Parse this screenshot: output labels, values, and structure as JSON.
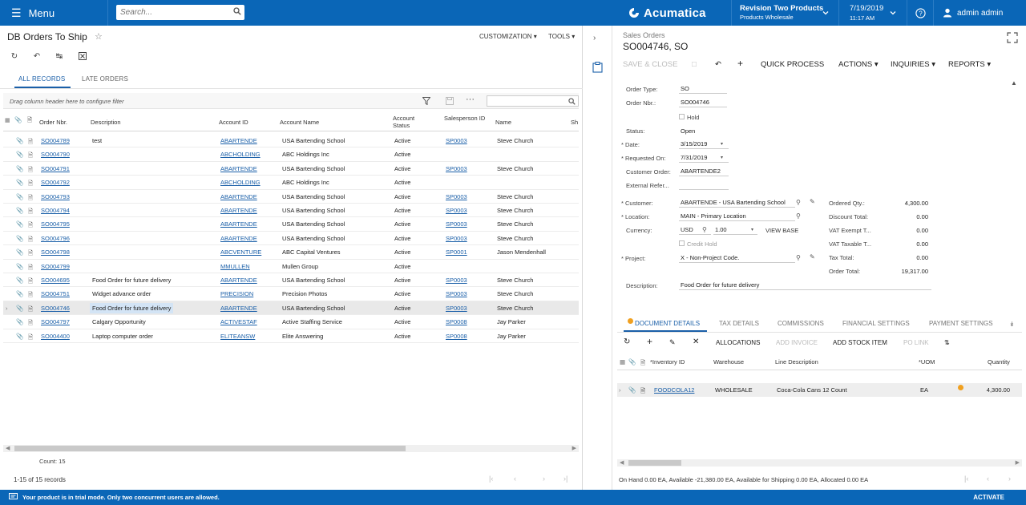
{
  "topbar": {
    "menu_label": "Menu",
    "search_placeholder": "Search...",
    "logo": "Acumatica",
    "company": "Revision Two Products",
    "branch": "Products Wholesale",
    "date": "7/19/2019",
    "time": "11:17 AM",
    "user": "admin admin"
  },
  "left": {
    "title": "DB Orders To Ship",
    "customization": "CUSTOMIZATION",
    "tools": "TOOLS",
    "tabs": [
      "ALL RECORDS",
      "LATE ORDERS"
    ],
    "drag_hint": "Drag column header here to configure filter",
    "columns": [
      "Order Nbr.",
      "Description",
      "Account ID",
      "Account Name",
      "Account Status",
      "Salesperson ID",
      "Name",
      "Sh"
    ],
    "rows": [
      {
        "order": "SO004789",
        "desc": "test",
        "acct": "ABARTENDE",
        "name": "USA Bartending School",
        "status": "Active",
        "sp": "SP0003",
        "spname": "Steve Church"
      },
      {
        "order": "SO004790",
        "desc": "",
        "acct": "ABCHOLDING",
        "name": "ABC Holdings Inc",
        "status": "Active",
        "sp": "",
        "spname": ""
      },
      {
        "order": "SO004791",
        "desc": "",
        "acct": "ABARTENDE",
        "name": "USA Bartending School",
        "status": "Active",
        "sp": "SP0003",
        "spname": "Steve Church"
      },
      {
        "order": "SO004792",
        "desc": "",
        "acct": "ABCHOLDING",
        "name": "ABC Holdings Inc",
        "status": "Active",
        "sp": "",
        "spname": ""
      },
      {
        "order": "SO004793",
        "desc": "",
        "acct": "ABARTENDE",
        "name": "USA Bartending School",
        "status": "Active",
        "sp": "SP0003",
        "spname": "Steve Church"
      },
      {
        "order": "SO004794",
        "desc": "",
        "acct": "ABARTENDE",
        "name": "USA Bartending School",
        "status": "Active",
        "sp": "SP0003",
        "spname": "Steve Church"
      },
      {
        "order": "SO004795",
        "desc": "",
        "acct": "ABARTENDE",
        "name": "USA Bartending School",
        "status": "Active",
        "sp": "SP0003",
        "spname": "Steve Church"
      },
      {
        "order": "SO004796",
        "desc": "",
        "acct": "ABARTENDE",
        "name": "USA Bartending School",
        "status": "Active",
        "sp": "SP0003",
        "spname": "Steve Church"
      },
      {
        "order": "SO004798",
        "desc": "",
        "acct": "ABCVENTURE",
        "name": "ABC Capital Ventures",
        "status": "Active",
        "sp": "SP0001",
        "spname": "Jason Mendenhall"
      },
      {
        "order": "SO004799",
        "desc": "",
        "acct": "MMULLEN",
        "name": "Mullen Group",
        "status": "Active",
        "sp": "",
        "spname": ""
      },
      {
        "order": "SO004695",
        "desc": "Food Order for future delivery",
        "acct": "ABARTENDE",
        "name": "USA Bartending School",
        "status": "Active",
        "sp": "SP0003",
        "spname": "Steve Church"
      },
      {
        "order": "SO004751",
        "desc": "Widget advance order",
        "acct": "PRECISION",
        "name": "Precision Photos",
        "status": "Active",
        "sp": "SP0003",
        "spname": "Steve Church"
      },
      {
        "order": "SO004746",
        "desc": "Food Order for future delivery",
        "acct": "ABARTENDE",
        "name": "USA Bartending School",
        "status": "Active",
        "sp": "SP0003",
        "spname": "Steve Church"
      },
      {
        "order": "SO004797",
        "desc": "Calgary Opportunity",
        "acct": "ACTIVESTAF",
        "name": "Active Staffing Service",
        "status": "Active",
        "sp": "SP0008",
        "spname": "Jay Parker"
      },
      {
        "order": "SO004400",
        "desc": "Laptop computer order",
        "acct": "ELITEANSW",
        "name": "Elite Answering",
        "status": "Active",
        "sp": "SP0008",
        "spname": "Jay Parker"
      }
    ],
    "count": "Count: 15",
    "records": "1-15 of 15 records"
  },
  "right": {
    "crumb": "Sales Orders",
    "title": "SO004746, SO",
    "toolbar": {
      "save_close": "SAVE & CLOSE",
      "quick_process": "QUICK PROCESS",
      "actions": "ACTIONS",
      "inquiries": "INQUIRIES",
      "reports": "REPORTS"
    },
    "form": {
      "order_type_label": "Order Type:",
      "order_type": "SO",
      "order_nbr_label": "Order Nbr.:",
      "order_nbr": "SO004746",
      "hold_label": "Hold",
      "status_label": "Status:",
      "status": "Open",
      "date_label": "Date:",
      "date": "3/15/2019",
      "requested_label": "Requested On:",
      "requested": "7/31/2019",
      "cust_order_label": "Customer Order:",
      "cust_order": "ABARTENDE2",
      "ext_ref_label": "External Refer...",
      "customer_label": "Customer:",
      "customer": "ABARTENDE - USA Bartending School",
      "location_label": "Location:",
      "location": "MAIN - Primary Location",
      "currency_label": "Currency:",
      "currency": "USD",
      "rate": "1.00",
      "view_base": "VIEW BASE",
      "credit_hold_label": "Credit Hold",
      "project_label": "Project:",
      "project": "X - Non-Project Code.",
      "description_label": "Description:",
      "description": "Food Order for future delivery",
      "ordered_qty_label": "Ordered Qty.:",
      "ordered_qty": "4,300.00",
      "discount_label": "Discount Total:",
      "discount": "0.00",
      "vat_exempt_label": "VAT Exempt T...",
      "vat_exempt": "0.00",
      "vat_taxable_label": "VAT Taxable T...",
      "vat_taxable": "0.00",
      "tax_total_label": "Tax Total:",
      "tax_total": "0.00",
      "order_total_label": "Order Total:",
      "order_total": "19,317.00"
    },
    "tabs": [
      "DOCUMENT DETAILS",
      "TAX DETAILS",
      "COMMISSIONS",
      "FINANCIAL SETTINGS",
      "PAYMENT SETTINGS"
    ],
    "detail_toolbar": [
      "ALLOCATIONS",
      "ADD INVOICE",
      "ADD STOCK ITEM",
      "PO LINK"
    ],
    "detail_columns": [
      "Inventory ID",
      "Warehouse",
      "Line Description",
      "UOM",
      "Quantity"
    ],
    "detail_row": {
      "inv": "FOODCOLA12",
      "wh": "WHOLESALE",
      "desc": "Coca-Cola Cans 12 Count",
      "uom": "EA",
      "qty": "4,300.00"
    },
    "availability": "On Hand 0.00 EA, Available -21,380.00 EA, Available for Shipping 0.00 EA, Allocated 0.00 EA"
  },
  "bottom": {
    "message": "Your product is in trial mode. Only two concurrent users are allowed.",
    "activate": "ACTIVATE"
  }
}
